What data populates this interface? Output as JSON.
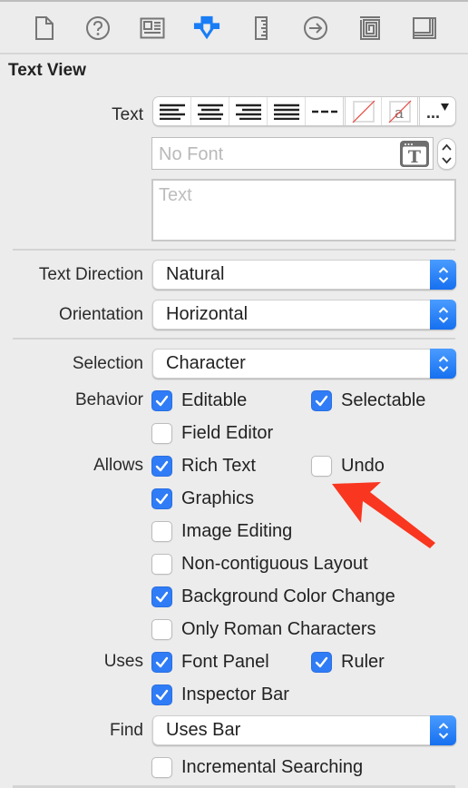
{
  "tabs": [
    {
      "name": "file-inspector",
      "icon": "file-icon",
      "active": false
    },
    {
      "name": "quick-help",
      "icon": "question-circle-icon",
      "active": false
    },
    {
      "name": "identity-inspector",
      "icon": "identity-card-icon",
      "active": false
    },
    {
      "name": "attributes-inspector",
      "icon": "attributes-shield-icon",
      "active": true
    },
    {
      "name": "size-inspector",
      "icon": "ruler-icon",
      "active": false
    },
    {
      "name": "connections-inspector",
      "icon": "arrow-circle-icon",
      "active": false
    },
    {
      "name": "bindings-inspector",
      "icon": "bindings-spiral-icon",
      "active": false
    },
    {
      "name": "view-effects-inspector",
      "icon": "view-effects-icon",
      "active": false
    }
  ],
  "section_title": "Text View",
  "text_row": {
    "label": "Text",
    "alignment_buttons": [
      "align-left",
      "align-center",
      "align-right",
      "align-justify",
      "align-natural"
    ],
    "color_buttons": [
      "text-color-none",
      "background-color-none"
    ],
    "more_label": "..."
  },
  "font_field": {
    "placeholder": "No Font"
  },
  "text_area": {
    "placeholder": "Text"
  },
  "text_direction": {
    "label": "Text Direction",
    "value": "Natural"
  },
  "orientation": {
    "label": "Orientation",
    "value": "Horizontal"
  },
  "selection": {
    "label": "Selection",
    "value": "Character"
  },
  "behavior": {
    "label": "Behavior",
    "editable": {
      "label": "Editable",
      "checked": true
    },
    "selectable": {
      "label": "Selectable",
      "checked": true
    },
    "field_editor": {
      "label": "Field Editor",
      "checked": false
    }
  },
  "allows": {
    "label": "Allows",
    "rich_text": {
      "label": "Rich Text",
      "checked": true
    },
    "undo": {
      "label": "Undo",
      "checked": false
    },
    "graphics": {
      "label": "Graphics",
      "checked": true
    },
    "image_editing": {
      "label": "Image Editing",
      "checked": false
    },
    "non_contiguous": {
      "label": "Non-contiguous Layout",
      "checked": false
    },
    "bg_color_change": {
      "label": "Background Color Change",
      "checked": true
    },
    "only_roman": {
      "label": "Only Roman Characters",
      "checked": false
    }
  },
  "uses": {
    "label": "Uses",
    "font_panel": {
      "label": "Font Panel",
      "checked": true
    },
    "ruler": {
      "label": "Ruler",
      "checked": true
    },
    "inspector_bar": {
      "label": "Inspector Bar",
      "checked": true
    }
  },
  "find": {
    "label": "Find",
    "value": "Uses Bar",
    "incremental": {
      "label": "Incremental Searching",
      "checked": false
    }
  },
  "colors": {
    "accent": "#2f7cf6",
    "active_tab": "#1a7df5",
    "annotation_arrow": "#f9361f",
    "background": "#ececec"
  }
}
